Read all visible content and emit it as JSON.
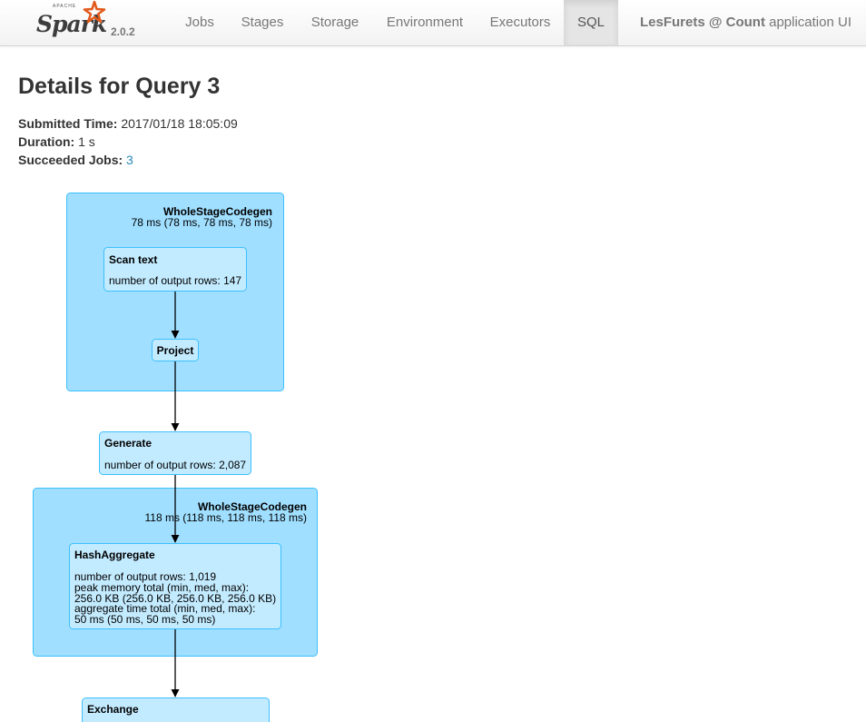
{
  "nav": {
    "version": "2.0.2",
    "brand_small": "APACHE",
    "brand_word": "Spark",
    "tabs": [
      {
        "label": "Jobs",
        "active": false
      },
      {
        "label": "Stages",
        "active": false
      },
      {
        "label": "Storage",
        "active": false
      },
      {
        "label": "Environment",
        "active": false
      },
      {
        "label": "Executors",
        "active": false
      },
      {
        "label": "SQL",
        "active": true
      }
    ],
    "app_name": "LesFurets @ Count",
    "app_suffix": " application UI"
  },
  "page": {
    "title": "Details for Query 3",
    "submitted_label": "Submitted Time:",
    "submitted_value": "2017/01/18 18:05:09",
    "duration_label": "Duration:",
    "duration_value": "1 s",
    "succeeded_label": "Succeeded Jobs:",
    "succeeded_value": "3"
  },
  "dag": {
    "cluster1": {
      "title": "WholeStageCodegen",
      "metric": "78 ms (78 ms, 78 ms, 78 ms)"
    },
    "scan": {
      "title": "Scan text",
      "metric": "number of output rows: 147"
    },
    "project": {
      "title": "Project"
    },
    "generate": {
      "title": "Generate",
      "metric": "number of output rows: 2,087"
    },
    "cluster2": {
      "title": "WholeStageCodegen",
      "metric": "118 ms (118 ms, 118 ms, 118 ms)"
    },
    "hashagg": {
      "title": "HashAggregate",
      "lines": [
        "number of output rows: 1,019",
        "peak memory total (min, med, max):",
        "256.0 KB (256.0 KB, 256.0 KB, 256.0 KB)",
        "aggregate time total (min, med, max):",
        "50 ms (50 ms, 50 ms, 50 ms)"
      ]
    },
    "exchange": {
      "title": "Exchange"
    }
  },
  "colors": {
    "cluster_fill": "#a0dfff",
    "node_fill": "#c3ebff",
    "border": "#3ec0ff",
    "link": "#2a8ab8"
  }
}
